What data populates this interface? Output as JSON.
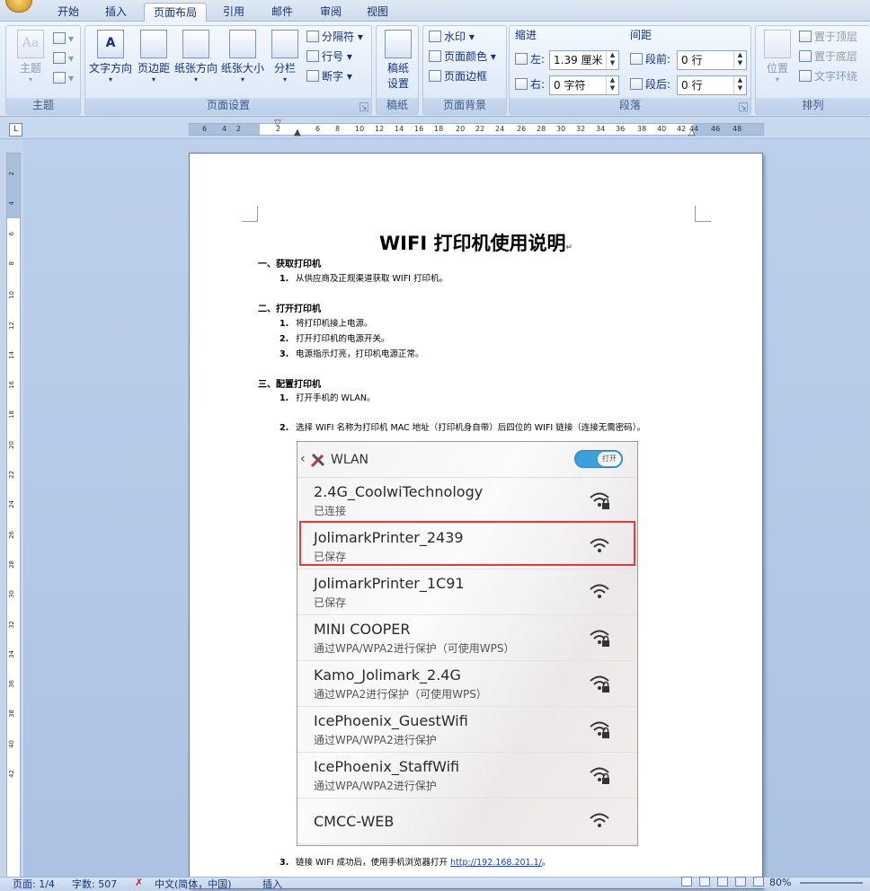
{
  "tabs": [
    "开始",
    "插入",
    "页面布局",
    "引用",
    "邮件",
    "审阅",
    "视图"
  ],
  "active_tab": "页面布局",
  "ribbon": {
    "theme_group": {
      "label": "主题",
      "themes_btn": "主题"
    },
    "page_setup": {
      "label": "页面设置",
      "text_direction": "文字方向",
      "margins": "页边距",
      "orientation": "纸张方向",
      "size": "纸张大小",
      "columns": "分栏",
      "breaks": "分隔符",
      "line_numbers": "行号",
      "hyphenation": "断字"
    },
    "draft": {
      "label": "稿纸",
      "btn": "稿纸\n设置",
      "btn_line1": "稿纸",
      "btn_line2": "设置"
    },
    "page_bg": {
      "label": "页面背景",
      "watermark": "水印",
      "page_color": "页面颜色",
      "page_borders": "页面边框"
    },
    "paragraph": {
      "label": "段落",
      "indent_title": "缩进",
      "spacing_title": "间距",
      "left_label": "左:",
      "left_value": "1.39 厘米",
      "right_label": "右:",
      "right_value": "0 字符",
      "before_label": "段前:",
      "before_value": "0 行",
      "after_label": "段后:",
      "after_value": "0 行"
    },
    "arrange": {
      "label": "排列",
      "position": "位置",
      "bring_front": "置于顶层",
      "send_back": "置于底层",
      "wrap_text": "文字环绕"
    }
  },
  "ruler_ticks": [
    "6",
    "4",
    "2",
    "2",
    "6",
    "8",
    "10",
    "12",
    "14",
    "16",
    "18",
    "20",
    "22",
    "24",
    "26",
    "28",
    "30",
    "32",
    "34",
    "36",
    "38",
    "40",
    "42",
    "44",
    "46",
    "48"
  ],
  "vruler_ticks": [
    "2",
    "4",
    "6",
    "8",
    "10",
    "12",
    "14",
    "16",
    "18",
    "20",
    "22",
    "24",
    "26",
    "28",
    "30",
    "32",
    "34",
    "36",
    "38",
    "40",
    "42"
  ],
  "document": {
    "title": "WIFI 打印机使用说明",
    "sections": [
      {
        "heading": "一、获取打印机",
        "items": [
          {
            "num": "1.",
            "text": "从供应商及正规渠道获取 WIFI 打印机。"
          }
        ]
      },
      {
        "heading": "二、打开打印机",
        "items": [
          {
            "num": "1.",
            "text": "将打印机接上电源。"
          },
          {
            "num": "2.",
            "text": "打开打印机的电源开关。"
          },
          {
            "num": "3.",
            "text": "电源指示灯亮，打印机电源正常。"
          }
        ]
      },
      {
        "heading": "三、配置打印机",
        "items": [
          {
            "num": "1.",
            "text": "打开手机的 WLAN。"
          },
          {
            "num": "2.",
            "text": "选择 WIFI 名称为打印机 MAC 地址（打印机身自带）后四位的 WIFI 链接（连接无需密码）。"
          }
        ]
      }
    ],
    "step3_num": "3.",
    "step3_text": "链接 WIFI 成功后，使用手机浏览器打开 ",
    "step3_link": "http://192.168.201.1/",
    "step3_end": "。"
  },
  "phone": {
    "title": "WLAN",
    "toggle": "打开",
    "networks": [
      {
        "name": "2.4G_CoolwiTechnology",
        "status": "已连接",
        "locked": true
      },
      {
        "name": "JolimarkPrinter_2439",
        "status": "已保存",
        "locked": false
      },
      {
        "name": "JolimarkPrinter_1C91",
        "status": "已保存",
        "locked": false
      },
      {
        "name": "MINI COOPER",
        "status": "通过WPA/WPA2进行保护（可使用WPS）",
        "locked": true
      },
      {
        "name": "Kamo_Jolimark_2.4G",
        "status": "通过WPA2进行保护（可使用WPS）",
        "locked": true
      },
      {
        "name": "IcePhoenix_GuestWifi",
        "status": "通过WPA/WPA2进行保护",
        "locked": true
      },
      {
        "name": "IcePhoenix_StaffWifi",
        "status": "通过WPA/WPA2进行保护",
        "locked": true
      },
      {
        "name": "CMCC-WEB",
        "status": "",
        "locked": false
      }
    ]
  },
  "statusbar": {
    "page": "页面: 1/4",
    "words": "字数: 507",
    "lang": "中文(简体，中国)",
    "mode": "插入",
    "zoom": "80%"
  },
  "colors": {
    "accent": "#3aa0dc",
    "highlight": "#e33b3b",
    "link": "#1a3fb8"
  }
}
